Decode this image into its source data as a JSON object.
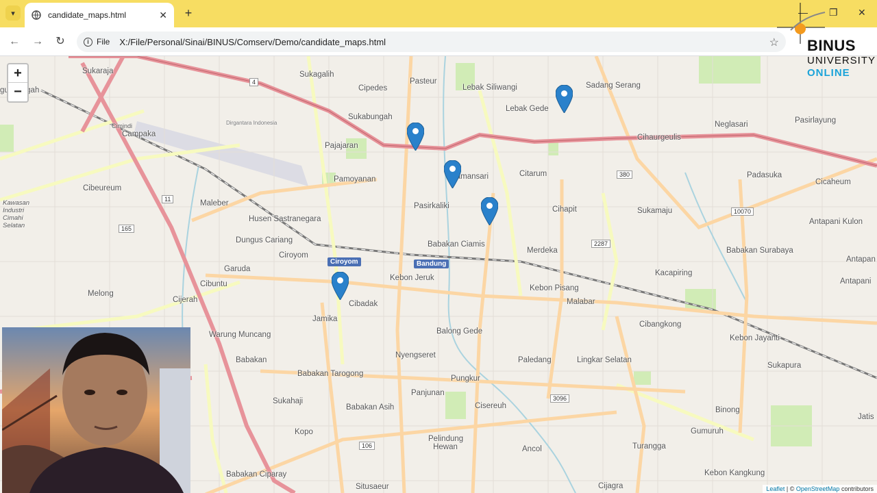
{
  "browser": {
    "tab_title": "candidate_maps.html",
    "new_tab_label": "+",
    "close_tab_label": "✕",
    "site_chip": "File",
    "url": "X:/File/Personal/Sinai/BINUS/Comserv/Demo/candidate_maps.html"
  },
  "map": {
    "zoom_in": "+",
    "zoom_out": "−",
    "place_labels": [
      "Sukaraja",
      "Sukagalih",
      "Cipedes",
      "Pasteur",
      "Lebak Siliwangi",
      "Sadang Serang",
      "gur Tengah",
      "Sukabungah",
      "Lebak Gede",
      "Neglasari",
      "Pasirlayung",
      "Cimindi",
      "Campaka",
      "Dirgantara Indonesia",
      "Pajajaran",
      "Cihaurgeulis",
      "Pamoyanan",
      "Tamansari",
      "Citarum",
      "Padasuka",
      "Cicaheum",
      "Cibeureum",
      "Kawasan Industri Cimahi Selatan",
      "Maleber",
      "Pasirkaliki",
      "Cihapit",
      "Sukamaju",
      "Antapani Kulon",
      "Husen Sastranegara",
      "Dungus Cariang",
      "Babakan Ciamis",
      "Merdeka",
      "Babakan Surabaya",
      "Antapan",
      "Ciroyom",
      "Garuda",
      "Kebon Jeruk",
      "Kacapiring",
      "Antapani",
      "Cibuntu",
      "Melong",
      "Cijerah",
      "Cibadak",
      "Kebon Pisang",
      "Malabar",
      "Jamika",
      "Cibangkong",
      "Kebon Jayanti",
      "Warung Muncang",
      "Balong Gede",
      "Babakan",
      "Nyengseret",
      "Paledang",
      "Lingkar Selatan",
      "Sukapura",
      "Babakan Tarogong",
      "Pungkur",
      "Panjunan",
      "Sukahaji",
      "Babakan Asih",
      "Cisereuh",
      "Binong",
      "Jatis",
      "Kopo",
      "Pelindung Hewan",
      "Ancol",
      "Gumuruh",
      "Turangga",
      "Babakan Ciparay",
      "Situsaeur",
      "Cijagra",
      "Kebon Kangkung"
    ],
    "stations": [
      "Ciroyom",
      "Bandung"
    ],
    "road_shields": [
      "4",
      "380",
      "10070",
      "11",
      "165",
      "2287",
      "3096",
      "106"
    ],
    "attribution": {
      "leaflet": "Leaflet",
      "sep": "| ©",
      "osm": "OpenStreetMap",
      "contributors": "contributors"
    },
    "marker_color": "#2a81cb"
  },
  "logo": {
    "line1": "BINUS",
    "line2": "UNIVERSITY",
    "line3": "ONLINE"
  },
  "colors": {
    "tabbar": "#f7dd62",
    "accent": "#1aa3d9"
  }
}
